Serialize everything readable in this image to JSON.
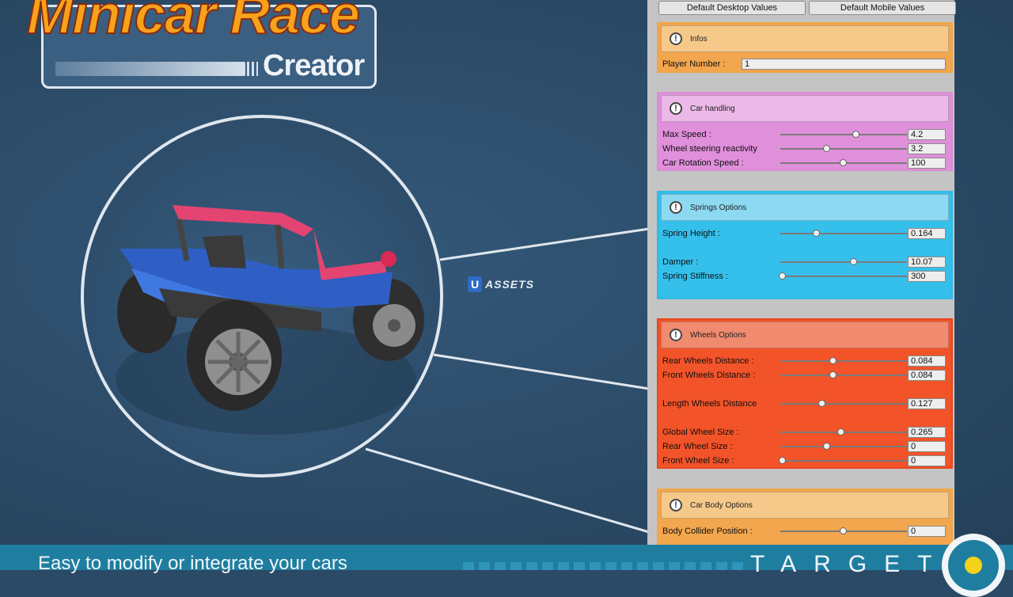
{
  "logo": {
    "title": "Minicar Race",
    "subtitle": "Creator"
  },
  "watermark": {
    "badge": "U",
    "text": "ASSETS"
  },
  "toolbar": {
    "desktop_label": "Default Desktop Values",
    "mobile_label": "Default Mobile Values"
  },
  "sections": {
    "infos": {
      "title": "Infos",
      "player_label": "Player Number :",
      "player_value": "1"
    },
    "car": {
      "title": "Car handling",
      "rows": [
        {
          "label": "Max Speed :",
          "value": "4.2",
          "slider": 0.6
        },
        {
          "label": "Wheel steering reactivity",
          "value": "3.2",
          "slider": 0.37
        },
        {
          "label": "Car Rotation Speed :",
          "value": "100",
          "slider": 0.5
        }
      ]
    },
    "springs": {
      "title": "Springs Options",
      "rows": [
        {
          "label": "Spring Height :",
          "value": "0.164",
          "slider": 0.29
        },
        {
          "label": "Damper :",
          "value": "10.07",
          "slider": 0.58
        },
        {
          "label": "Spring Stiffness :",
          "value": "300",
          "slider": 0.02
        }
      ]
    },
    "wheels": {
      "title": "Wheels Options",
      "rows": [
        {
          "label": "Rear Wheels Distance :",
          "value": "0.084",
          "slider": 0.42
        },
        {
          "label": "Front Wheels Distance :",
          "value": "0.084",
          "slider": 0.42
        },
        {
          "label": "Length Wheels Distance",
          "value": "0.127",
          "slider": 0.33
        },
        {
          "label": "Global Wheel Size :",
          "value": "0.265",
          "slider": 0.48
        },
        {
          "label": "Rear Wheel Size :",
          "value": "0",
          "slider": 0.37
        },
        {
          "label": "Front Wheel Size :",
          "value": "0",
          "slider": 0.02
        }
      ]
    },
    "body": {
      "title": "Car Body Options",
      "rows": [
        {
          "label": "Body Collider Position :",
          "value": "0",
          "slider": 0.5
        }
      ]
    }
  },
  "banner": {
    "text": "Easy to modify or integrate your cars",
    "brand": "TARGET"
  },
  "colors": {
    "infos": "#f2a64d",
    "car": "#e090db",
    "springs": "#35c0ec",
    "wheels": "#f25328",
    "banner": "#1f7ea0"
  }
}
